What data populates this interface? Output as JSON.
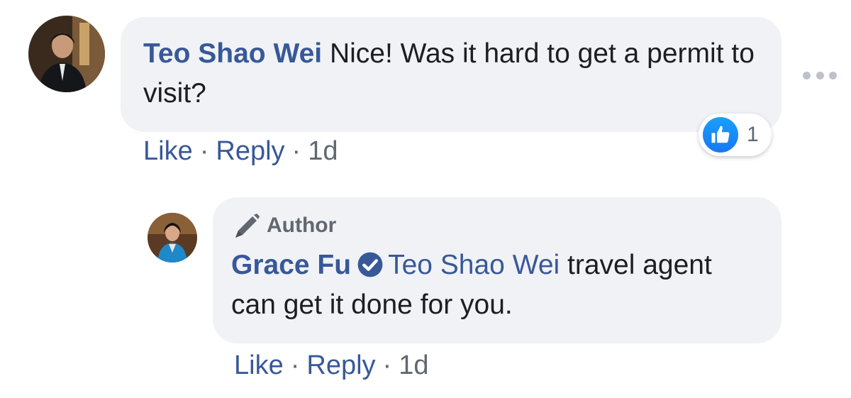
{
  "comment": {
    "author_name": "Teo Shao Wei",
    "text": "Nice! Was it hard to get a permit to visit?",
    "actions": {
      "like": "Like",
      "reply": "Reply",
      "separator": "·",
      "time": "1d"
    },
    "reaction": {
      "icon": "like-icon",
      "count": "1"
    },
    "more_icon": "more-options-icon"
  },
  "reply": {
    "badge_icon": "pen-icon",
    "badge_label": "Author",
    "author_name": "Grace Fu",
    "verified_icon": "verified-badge-icon",
    "mention": "Teo Shao Wei",
    "text": "travel agent can get it done for you.",
    "actions": {
      "like": "Like",
      "reply": "Reply",
      "separator": "·",
      "time": "1d"
    }
  },
  "colors": {
    "link": "#385898",
    "bubble": "#f0f2f5",
    "muted": "#606770",
    "like_blue": "#1877f2"
  }
}
